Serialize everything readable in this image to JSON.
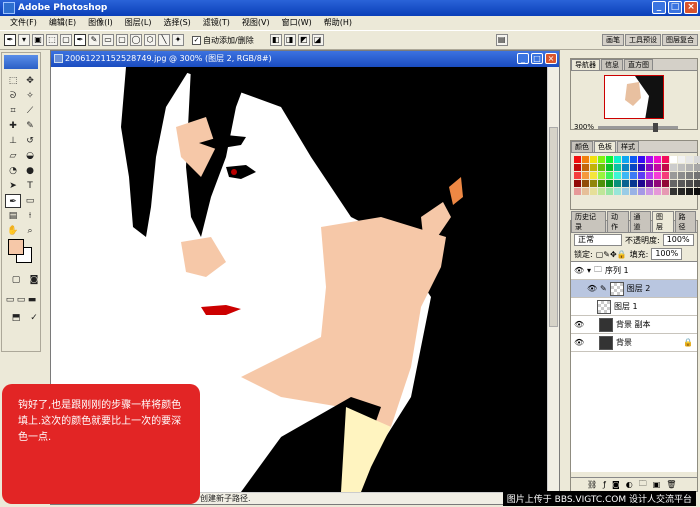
{
  "app": {
    "title": "Adobe Photoshop"
  },
  "menu": [
    "文件(F)",
    "编辑(E)",
    "图像(I)",
    "图层(L)",
    "选择(S)",
    "滤镜(T)",
    "视图(V)",
    "窗口(W)",
    "帮助(H)"
  ],
  "options": {
    "auto_add_label": "自动添加/删除",
    "auto_add_checked": "✓"
  },
  "dock_tabs": [
    "画笔",
    "工具预设",
    "图层复合"
  ],
  "document": {
    "title": "20061221152528749.jpg @ 300% (图层 2, RGB/8#)"
  },
  "callout": {
    "text": "钩好了,也是跟刚刚的步骤一样将颜色填上.这次的颜色就要比上一次的要深色一点."
  },
  "status": {
    "text": "创建新子路径."
  },
  "watermark": {
    "text": "图片上传于 BBS.VIGTC.COM 设计人交流平台"
  },
  "navigator": {
    "tabs": [
      "导航器",
      "信息",
      "直方图"
    ],
    "zoom": "300%"
  },
  "color_panel": {
    "tabs": [
      "颜色",
      "色板",
      "样式"
    ]
  },
  "layers_panel": {
    "tabs": [
      "历史记录",
      "动作",
      "通道",
      "图层",
      "路径"
    ],
    "blend_mode": "正常",
    "opacity_label": "不透明度:",
    "opacity": "100%",
    "lock_label": "锁定:",
    "fill_label": "填充:",
    "fill": "100%",
    "layers": [
      {
        "name": "序列 1",
        "type": "group"
      },
      {
        "name": "图层 2",
        "type": "layer",
        "selected": true
      },
      {
        "name": "图层 1",
        "type": "layer"
      },
      {
        "name": "背景 副本",
        "type": "photo"
      },
      {
        "name": "背景",
        "type": "photo"
      }
    ]
  },
  "colors": {
    "foreground": "#f6c8a8",
    "background": "#ffffff",
    "callout": "#e22525"
  }
}
